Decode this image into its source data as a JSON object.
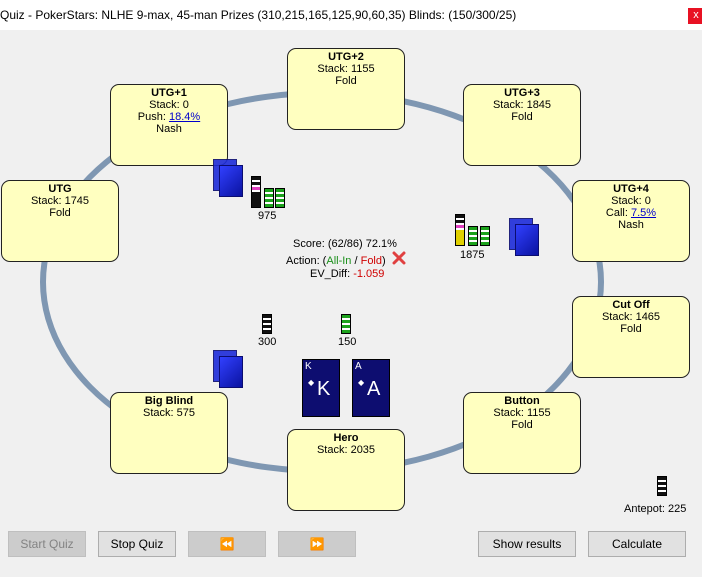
{
  "window": {
    "title": "Quiz - PokerStars: NLHE 9-max, 45-man Prizes (310,215,165,125,90,60,35) Blinds: (150/300/25)",
    "close_label": "x"
  },
  "seats": {
    "utg2": {
      "name": "UTG+2",
      "stack": "Stack: 1155",
      "action": "Fold"
    },
    "utg1": {
      "name": "UTG+1",
      "stack": "Stack: 0",
      "push_label": "Push: ",
      "push_value": "18.4%",
      "note": "Nash"
    },
    "utg3": {
      "name": "UTG+3",
      "stack": "Stack: 1845",
      "action": "Fold"
    },
    "utg": {
      "name": "UTG",
      "stack": "Stack: 1745",
      "action": "Fold"
    },
    "utg4": {
      "name": "UTG+4",
      "stack": "Stack: 0",
      "call_label": "Call: ",
      "call_value": "7.5%",
      "note": "Nash"
    },
    "cutoff": {
      "name": "Cut Off",
      "stack": "Stack: 1465",
      "action": "Fold"
    },
    "button": {
      "name": "Button",
      "stack": "Stack: 1155",
      "action": "Fold"
    },
    "bigblind": {
      "name": "Big Blind",
      "stack": "Stack: 575"
    },
    "hero": {
      "name": "Hero",
      "stack": "Stack: 2035"
    }
  },
  "bets": {
    "utg1": "975",
    "utg4": "1875",
    "bigblind": "300",
    "smallblind": "150"
  },
  "antepot": "Antepot: 225",
  "quiz": {
    "score": "Score: (62/86) 72.1%",
    "action_prefix": "Action: (",
    "action_allin": "All-In",
    "action_sep": " / ",
    "action_fold": "Fold",
    "action_suffix": ")",
    "ev_label": "EV_Diff: ",
    "ev_value": "-1.059"
  },
  "hero_cards": [
    {
      "rank": "K"
    },
    {
      "rank": "A"
    }
  ],
  "buttons": {
    "start_quiz": "Start Quiz",
    "stop_quiz": "Stop Quiz",
    "prev": "⏪",
    "next": "⏩",
    "show_results": "Show results",
    "calculate": "Calculate"
  },
  "colors": {
    "seat_bg": "#ffffc0",
    "table_ring": "#7f97b2",
    "card_bg": "#0d0d70",
    "close_red": "#e81123"
  },
  "icons": [
    "close-icon",
    "x-mark-icon",
    "chip-stack-icon",
    "card-deck-icon"
  ]
}
